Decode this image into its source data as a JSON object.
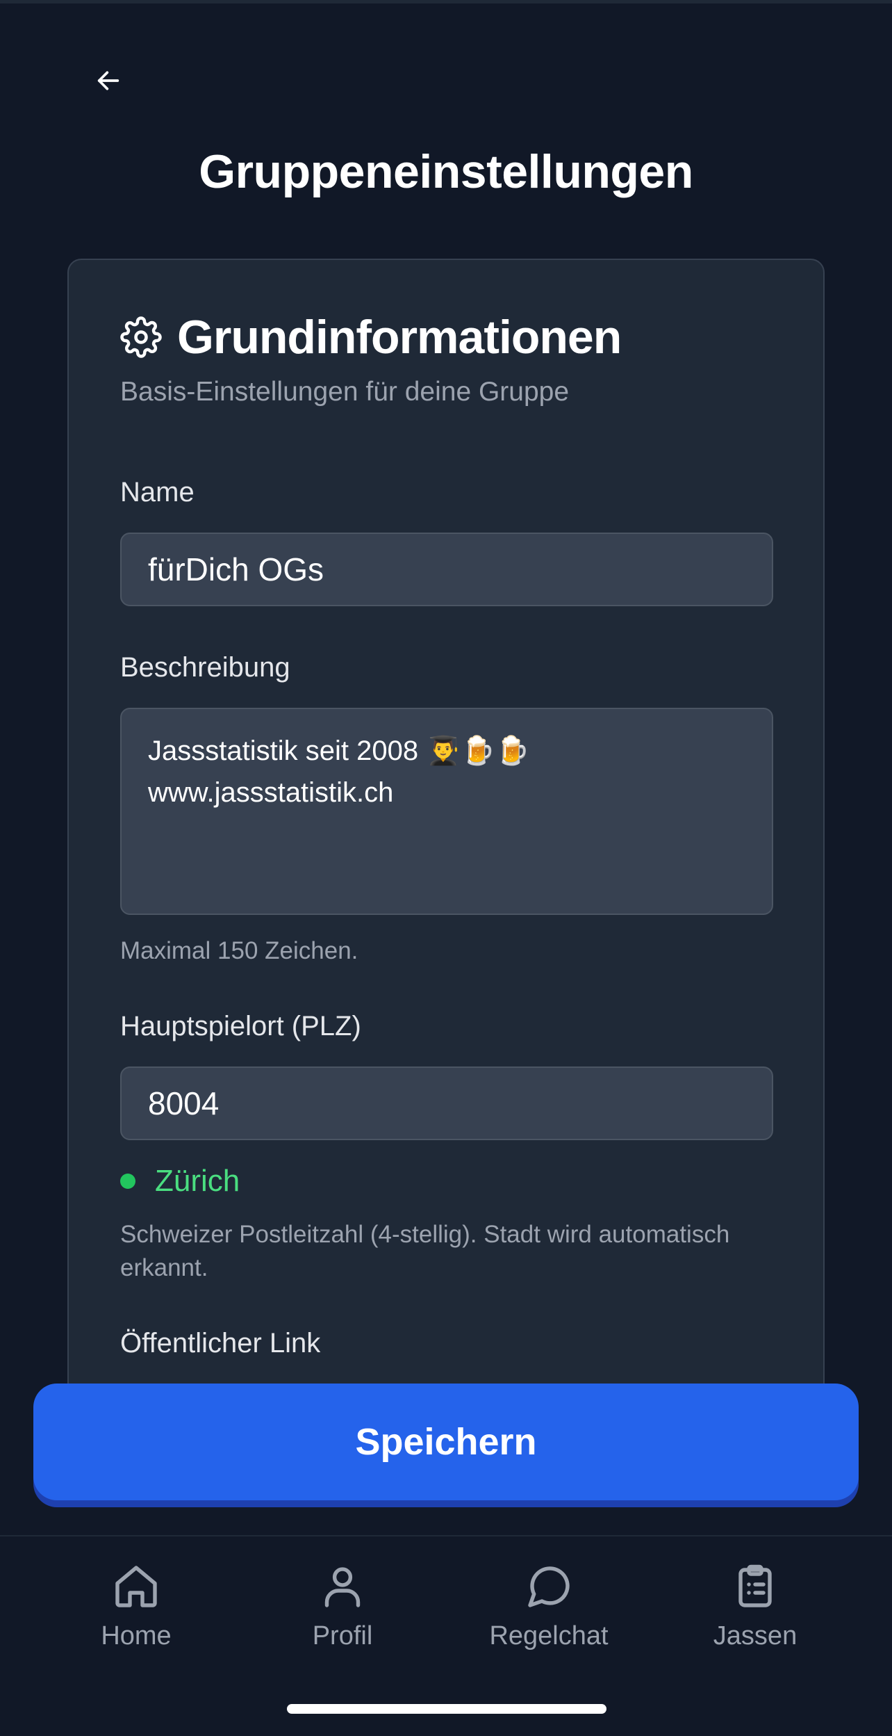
{
  "header": {
    "title": "Gruppeneinstellungen"
  },
  "card": {
    "icon": "gear-icon",
    "title": "Grundinformationen",
    "subtitle": "Basis-Einstellungen für deine Gruppe"
  },
  "form": {
    "name_label": "Name",
    "name_value": "fürDich OGs",
    "description_label": "Beschreibung",
    "description_value": "Jassstatistik seit 2008 👨‍🎓🍺🍺\nwww.jassstatistik.ch",
    "description_help": "Maximal 150 Zeichen.",
    "plz_label": "Hauptspielort (PLZ)",
    "plz_value": "8004",
    "plz_city": "Zürich",
    "plz_help": "Schweizer Postleitzahl (4-stellig). Stadt wird automatisch erkannt.",
    "public_link_label": "Öffentlicher Link"
  },
  "save_button": "Speichern",
  "tabs": [
    {
      "label": "Home",
      "icon": "home-icon"
    },
    {
      "label": "Profil",
      "icon": "user-icon"
    },
    {
      "label": "Regelchat",
      "icon": "chat-bubble-icon"
    },
    {
      "label": "Jassen",
      "icon": "clipboard-icon"
    }
  ],
  "colors": {
    "background": "#111827",
    "card": "#1f2937",
    "input": "#374151",
    "accent": "#2563eb",
    "success": "#22c55e"
  }
}
